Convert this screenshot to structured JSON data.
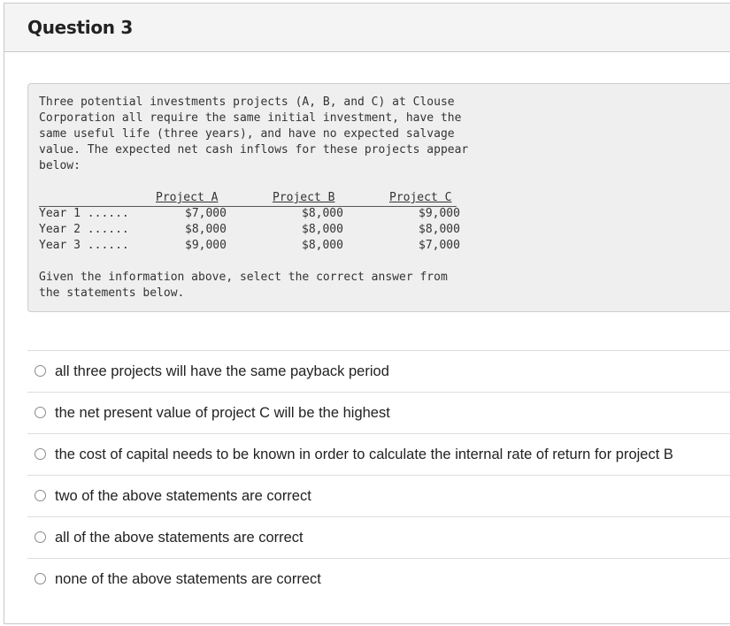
{
  "question": {
    "title": "Question 3",
    "intro_text": "Three potential investments projects (A, B, and C) at Clouse\nCorporation all require the same initial investment, have the\nsame useful life (three years), and have no expected salvage\nvalue. The expected net cash inflows for these projects appear\nbelow:",
    "table": {
      "headers": [
        "Project A",
        "Project B",
        "Project C"
      ],
      "rows": [
        {
          "label": "Year 1 ......",
          "values": [
            "$7,000",
            "$8,000",
            "$9,000"
          ]
        },
        {
          "label": "Year 2 ......",
          "values": [
            "$8,000",
            "$8,000",
            "$8,000"
          ]
        },
        {
          "label": "Year 3 ......",
          "values": [
            "$9,000",
            "$8,000",
            "$7,000"
          ]
        }
      ]
    },
    "prompt_text": "Given the information above, select the correct answer from\nthe statements below."
  },
  "options": [
    {
      "label": "all three projects will have the same payback period",
      "selected": false
    },
    {
      "label": "the net present value of project C will be the highest",
      "selected": false
    },
    {
      "label": "the cost of capital needs to be known in order to calculate the internal rate of return for project B",
      "selected": false
    },
    {
      "label": "two of the above statements are correct",
      "selected": false
    },
    {
      "label": "all of the above statements are correct",
      "selected": false
    },
    {
      "label": "none of the above statements are correct",
      "selected": false
    }
  ]
}
